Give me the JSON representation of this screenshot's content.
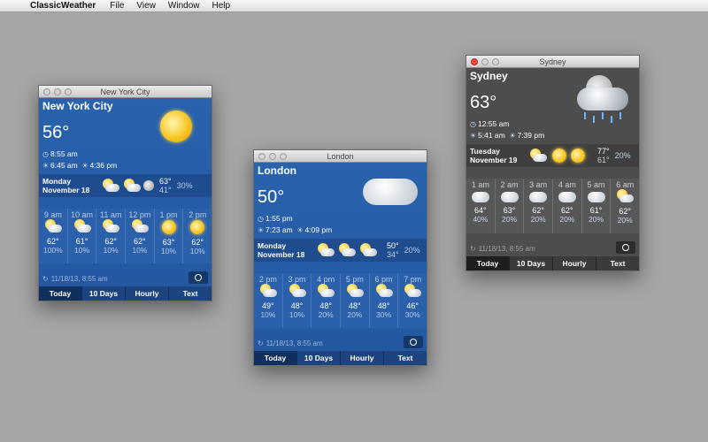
{
  "menubar": {
    "app": "ClassicWeather",
    "items": [
      "File",
      "View",
      "Window",
      "Help"
    ]
  },
  "windows": {
    "newyork": {
      "title": "New York City",
      "city": "New York City",
      "temp": "56°",
      "time": "8:55 am",
      "sunrise": "6:45 am",
      "sunset": "4:36 pm",
      "day": "Monday",
      "date": "November 18",
      "hi": "63°",
      "lo": "41°",
      "pct": "30%",
      "hours": [
        {
          "label": "9 am",
          "temp": "62°",
          "pct": "100%",
          "icon": "partly-cloudy-icon"
        },
        {
          "label": "10 am",
          "temp": "61°",
          "pct": "10%",
          "icon": "partly-cloudy-icon"
        },
        {
          "label": "11 am",
          "temp": "62°",
          "pct": "10%",
          "icon": "partly-cloudy-icon"
        },
        {
          "label": "12 pm",
          "temp": "62°",
          "pct": "10%",
          "icon": "partly-cloudy-icon"
        },
        {
          "label": "1 pm",
          "temp": "63°",
          "pct": "10%",
          "icon": "sun-icon"
        },
        {
          "label": "2 pm",
          "temp": "62°",
          "pct": "10%",
          "icon": "sun-icon"
        }
      ],
      "updated": "11/18/13, 8:55 am",
      "tabs": [
        "Today",
        "10 Days",
        "Hourly",
        "Text"
      ]
    },
    "london": {
      "title": "London",
      "city": "London",
      "temp": "50°",
      "time": "1:55 pm",
      "sunrise": "7:23 am",
      "sunset": "4:09 pm",
      "day": "Monday",
      "date": "November 18",
      "hi": "50°",
      "lo": "34°",
      "pct": "20%",
      "hours": [
        {
          "label": "2 pm",
          "temp": "49°",
          "pct": "10%",
          "icon": "partly-cloudy-icon"
        },
        {
          "label": "3 pm",
          "temp": "48°",
          "pct": "10%",
          "icon": "partly-cloudy-icon"
        },
        {
          "label": "4 pm",
          "temp": "48°",
          "pct": "20%",
          "icon": "partly-cloudy-icon"
        },
        {
          "label": "5 pm",
          "temp": "48°",
          "pct": "20%",
          "icon": "partly-cloudy-icon"
        },
        {
          "label": "6 pm",
          "temp": "48°",
          "pct": "30%",
          "icon": "partly-cloudy-icon"
        },
        {
          "label": "7 pm",
          "temp": "46°",
          "pct": "30%",
          "icon": "partly-cloudy-icon"
        }
      ],
      "updated": "11/18/13, 8:55 am",
      "tabs": [
        "Today",
        "10 Days",
        "Hourly",
        "Text"
      ]
    },
    "sydney": {
      "title": "Sydney",
      "city": "Sydney",
      "temp": "63°",
      "time": "12:55 am",
      "sunrise": "5:41 am",
      "sunset": "7:39 pm",
      "day": "Tuesday",
      "date": "November 19",
      "hi": "77°",
      "lo": "61°",
      "pct": "20%",
      "hours": [
        {
          "label": "1 am",
          "temp": "64°",
          "pct": "40%",
          "icon": "cloudy-icon"
        },
        {
          "label": "2 am",
          "temp": "63°",
          "pct": "20%",
          "icon": "cloudy-icon"
        },
        {
          "label": "3 am",
          "temp": "62°",
          "pct": "20%",
          "icon": "cloudy-icon"
        },
        {
          "label": "4 am",
          "temp": "62°",
          "pct": "20%",
          "icon": "cloudy-icon"
        },
        {
          "label": "5 am",
          "temp": "61°",
          "pct": "20%",
          "icon": "cloudy-icon"
        },
        {
          "label": "6 am",
          "temp": "62°",
          "pct": "20%",
          "icon": "partly-cloudy-icon"
        }
      ],
      "updated": "11/18/13, 8:55 am",
      "tabs": [
        "Today",
        "10 Days",
        "Hourly",
        "Text"
      ]
    }
  }
}
